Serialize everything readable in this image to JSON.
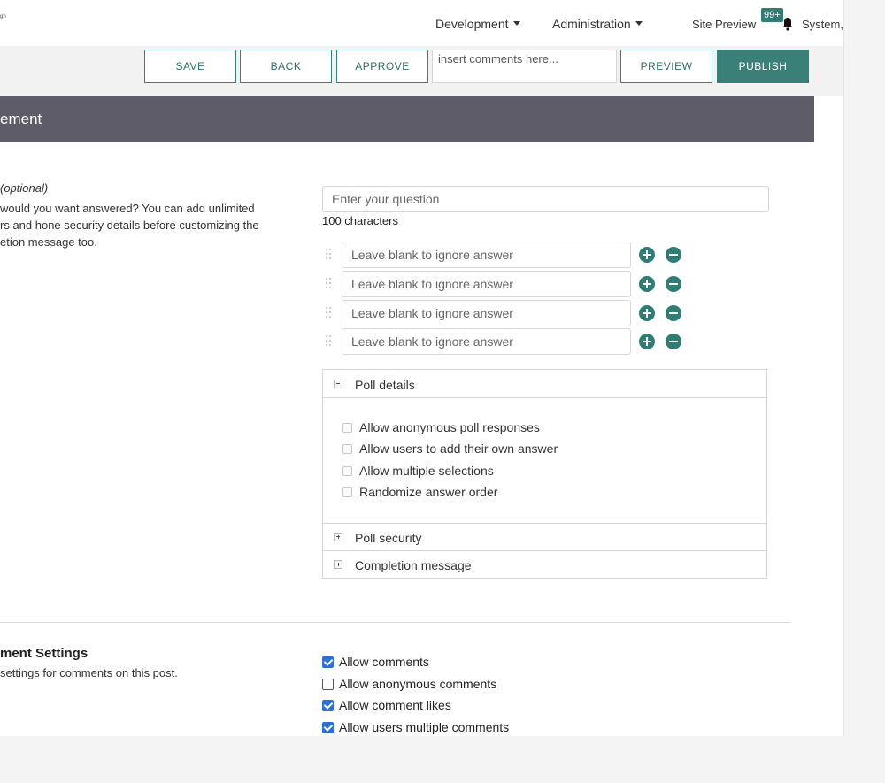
{
  "topnav": {
    "logo_text": "ᵍʰ",
    "development": "Development",
    "administration": "Administration",
    "site_preview": "Site Preview",
    "notifications_count": "99+",
    "user_name": "System,"
  },
  "toolbar": {
    "save": "SAVE",
    "back": "BACK",
    "approve": "APPROVE",
    "comments_placeholder": "insert comments here...",
    "preview": "PREVIEW",
    "publish": "PUBLISH"
  },
  "header": {
    "title": "ement"
  },
  "poll": {
    "optional_label": "(optional)",
    "description_lines": [
      "would you want answered? You can add unlimited",
      "rs and hone security details before customizing the",
      "etion message too."
    ],
    "question_placeholder": "Enter your question",
    "char_limit": "100 characters",
    "answers": [
      {
        "placeholder": "Leave blank to ignore answer"
      },
      {
        "placeholder": "Leave blank to ignore answer"
      },
      {
        "placeholder": "Leave blank to ignore answer"
      },
      {
        "placeholder": "Leave blank to ignore answer"
      }
    ],
    "details": {
      "title": "Poll details",
      "options": [
        "Allow anonymous poll responses",
        "Allow users to add their own answer",
        "Allow multiple selections",
        "Randomize answer order"
      ]
    },
    "security_title": "Poll security",
    "completion_title": "Completion message"
  },
  "comment_settings": {
    "title": "ment Settings",
    "description": "settings for comments on this post.",
    "options": [
      {
        "label": "Allow comments",
        "checked": true
      },
      {
        "label": "Allow anonymous comments",
        "checked": false
      },
      {
        "label": "Allow comment likes",
        "checked": true
      },
      {
        "label": "Allow users multiple comments",
        "checked": true
      }
    ]
  }
}
